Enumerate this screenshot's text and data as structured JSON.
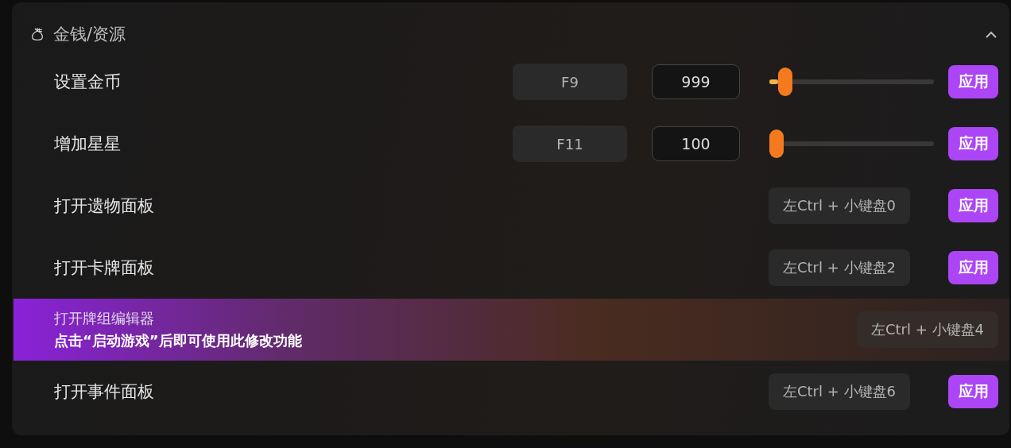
{
  "section": {
    "title": "金钱/资源",
    "expanded": true
  },
  "rows": [
    {
      "kind": "slider",
      "label": "设置金币",
      "hotkey": "F9",
      "value": "999",
      "level": 0.06,
      "button": "应用"
    },
    {
      "kind": "slider",
      "label": "增加星星",
      "hotkey": "F11",
      "value": "100",
      "level": 0,
      "button": "应用"
    },
    {
      "kind": "hotkey",
      "label": "打开遗物面板",
      "hotkey": "左Ctrl + 小键盘0",
      "button": "应用"
    },
    {
      "kind": "hotkey",
      "label": "打开卡牌面板",
      "hotkey": "左Ctrl + 小键盘2",
      "button": "应用"
    },
    {
      "kind": "tip",
      "label": "打开牌组编辑器",
      "tip": "点击“启动游戏”后即可使用此修改功能",
      "hotkey": "左Ctrl + 小键盘4"
    },
    {
      "kind": "hotkey",
      "label": "打开事件面板",
      "hotkey": "左Ctrl + 小键盘6",
      "button": "应用"
    }
  ]
}
